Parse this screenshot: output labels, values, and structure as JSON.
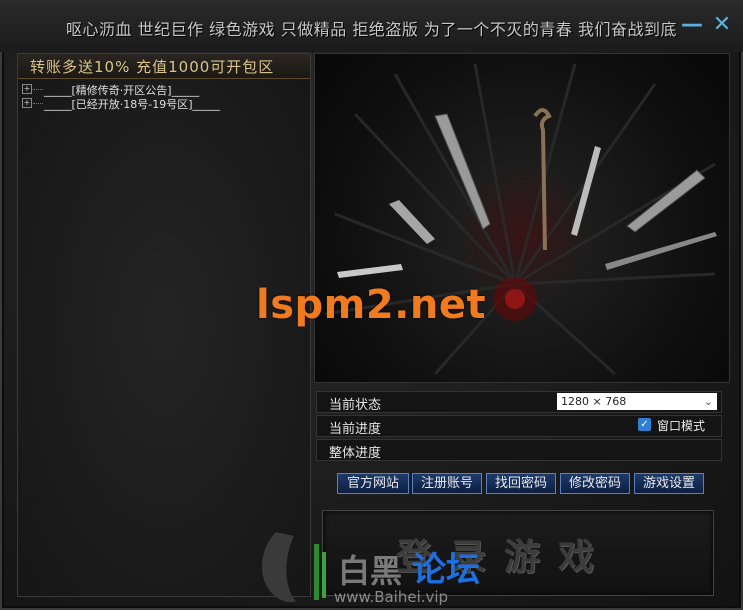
{
  "window": {
    "title": "呕心沥血 世纪巨作 绿色游戏 只做精品 拒绝盗版 为了一个不灭的青春 我们奋战到底",
    "minimize_glyph": "—",
    "close_glyph": "✕",
    "accent": "#5ab0e0"
  },
  "left_panel": {
    "promo": "转账多送10% 充值1000可开包区",
    "tree": [
      {
        "expander": "+",
        "label": "_____[精修传奇·开区公告]_____"
      },
      {
        "expander": "+",
        "label": "_____[已经开放·18号-19号区]_____"
      }
    ]
  },
  "watermark": "lspm2.net",
  "status": {
    "current_state_label": "当前状态",
    "resolution_value": "1280 × 768",
    "current_progress_label": "当前进度",
    "window_mode_label": "窗口模式",
    "window_mode_checked": true,
    "overall_progress_label": "整体进度"
  },
  "buttons": [
    "官方网站",
    "注册账号",
    "找回密码",
    "修改密码",
    "游戏设置"
  ],
  "login_text": "登录游戏",
  "site": {
    "name_a": "白黑",
    "name_b": "论坛",
    "url": "www.Baihei.vip"
  }
}
